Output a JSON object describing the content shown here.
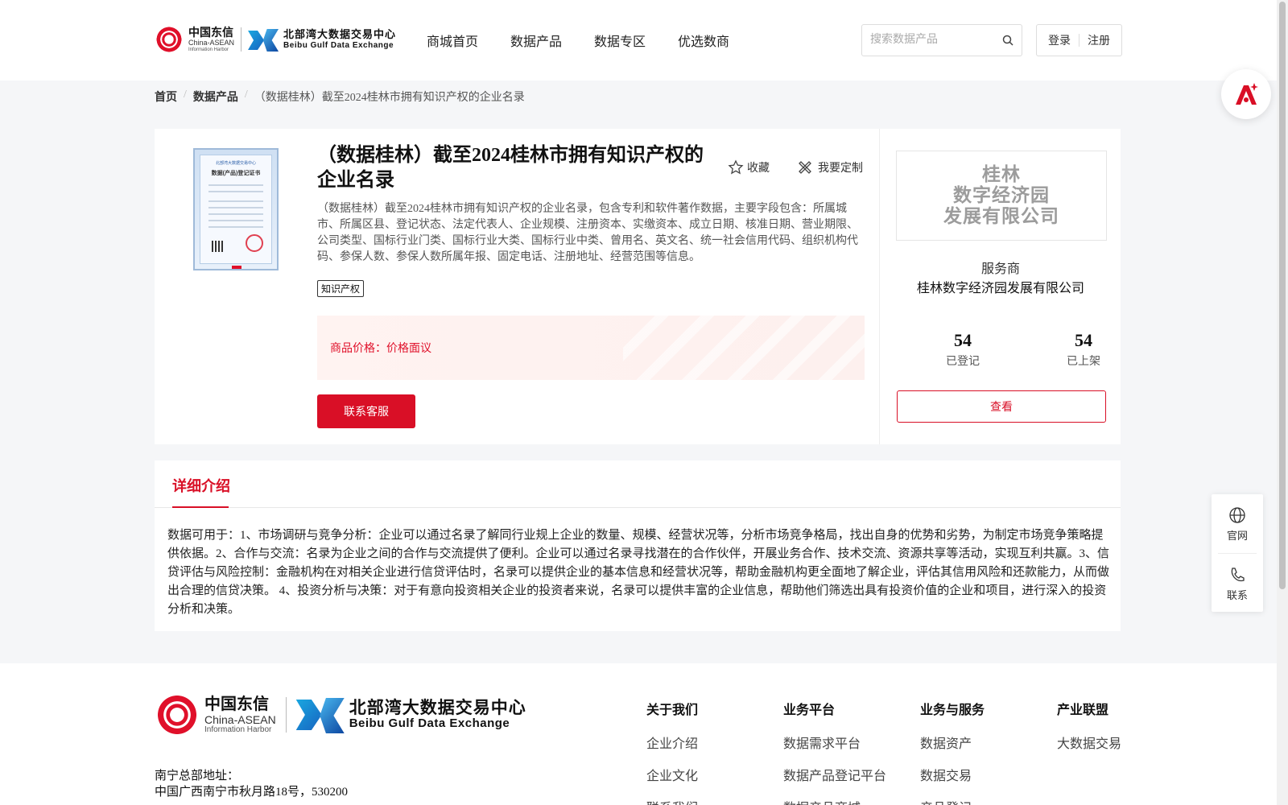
{
  "brand": {
    "cn": "中国东信",
    "en": "China-ASEAN",
    "sub": "Information Harbor",
    "exchange_cn": "北部湾大数据交易中心",
    "exchange_en": "Beibu Gulf Data Exchange"
  },
  "nav": [
    "商城首页",
    "数据产品",
    "数据专区",
    "优选数商"
  ],
  "search": {
    "placeholder": "搜索数据产品"
  },
  "auth": {
    "login": "登录",
    "register": "注册"
  },
  "breadcrumb": [
    "首页",
    "数据产品",
    "（数据桂林）截至2024桂林市拥有知识产权的企业名录"
  ],
  "product": {
    "title": "（数据桂林）截至2024桂林市拥有知识产权的企业名录",
    "favorite": "收藏",
    "customize": "我要定制",
    "description": "（数据桂林）截至2024桂林市拥有知识产权的企业名录，包含专利和软件著作数据，主要字段包含：所属城市、所属区县、登记状态、法定代表人、企业规模、注册资本、实缴资本、成立日期、核准日期、营业期限、公司类型、国标行业门类、国标行业大类、国标行业中类、曾用名、英文名、统一社会信用代码、组织机构代码、参保人数、参保人数所属年报、固定电话、注册地址、经营范围等信息。",
    "tag": "知识产权",
    "price_label": "商品价格：价格面议",
    "contact_button": "联系客服",
    "certificate": {
      "header": "北部湾大数据交易中心",
      "title": "数据(产品)登记证书"
    }
  },
  "provider": {
    "logo_text": "桂林\n数字经济园\n发展有限公司",
    "role": "服务商",
    "name": "桂林数字经济园发展有限公司",
    "registered_count": "54",
    "registered_label": "已登记",
    "listed_count": "54",
    "listed_label": "已上架",
    "view_button": "查看"
  },
  "detail": {
    "tab": "详细介绍",
    "text": "数据可用于：1、市场调研与竞争分析：企业可以通过名录了解同行业规上企业的数量、规模、经营状况等，分析市场竞争格局，找出自身的优势和劣势，为制定市场竞争策略提供依据。2、合作与交流：名录为企业之间的合作与交流提供了便利。企业可以通过名录寻找潜在的合作伙伴，开展业务合作、技术交流、资源共享等活动，实现互利共赢。3、信贷评估与风险控制：金融机构在对相关企业进行信贷评估时，名录可以提供企业的基本信息和经营状况等，帮助金融机构更全面地了解企业，评估其信用风险和还款能力，从而做出合理的信贷决策。 4、投资分析与决策：对于有意向投资相关企业的投资者来说，名录可以提供丰富的企业信息，帮助他们筛选出具有投资价值的企业和项目，进行深入的投资分析和决策。"
  },
  "tools": {
    "website": "官网",
    "contact": "联系"
  },
  "footer": {
    "address_label": "南宁总部地址：",
    "address": "中国广西南宁市秋月路18号，530200",
    "columns": [
      {
        "title": "关于我们",
        "items": [
          "企业介绍",
          "企业文化",
          "联系我们"
        ]
      },
      {
        "title": "业务平台",
        "items": [
          "数据需求平台",
          "数据产品登记平台",
          "数据产品商城"
        ]
      },
      {
        "title": "业务与服务",
        "items": [
          "数据资产",
          "数据交易",
          "产品登记"
        ]
      },
      {
        "title": "产业联盟",
        "items": [
          "大数据交易"
        ]
      }
    ]
  },
  "colors": {
    "accent": "#d90f26",
    "page_bg": "#f5f6f8"
  }
}
